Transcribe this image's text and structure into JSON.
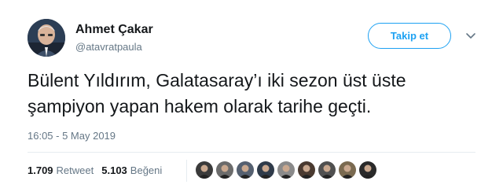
{
  "user": {
    "name": "Ahmet Çakar",
    "handle": "@atavratpaula",
    "avatar_icon": "profile-photo"
  },
  "follow_button": {
    "label": "Takip et"
  },
  "menu": {
    "icon": "chevron-down-icon"
  },
  "tweet": {
    "line1": "Bülent Yıldırım, Galatasaray’ı iki sezon üst üste",
    "line2": "şampiyon yapan hakem olarak tarihe geçti.",
    "timestamp": "16:05 - 5 May 2019"
  },
  "stats": {
    "retweets_count": "1.709",
    "retweets_label": "Retweet",
    "likes_count": "5.103",
    "likes_label": "Beğeni"
  },
  "likers": [
    {
      "icon": "liker-avatar-1",
      "color": "#3a3a3a"
    },
    {
      "icon": "liker-avatar-2",
      "color": "#6b6b6b"
    },
    {
      "icon": "liker-avatar-3",
      "color": "#556070"
    },
    {
      "icon": "liker-avatar-4",
      "color": "#2f3b4a"
    },
    {
      "icon": "liker-avatar-5",
      "color": "#8a8a8a"
    },
    {
      "icon": "liker-avatar-6",
      "color": "#4a3a30"
    },
    {
      "icon": "liker-avatar-7",
      "color": "#505050"
    },
    {
      "icon": "liker-avatar-8",
      "color": "#7a6a50"
    },
    {
      "icon": "liker-avatar-9",
      "color": "#2a2a2a"
    }
  ],
  "colors": {
    "accent": "#1da1f2",
    "muted": "#657786",
    "text": "#14171a"
  }
}
